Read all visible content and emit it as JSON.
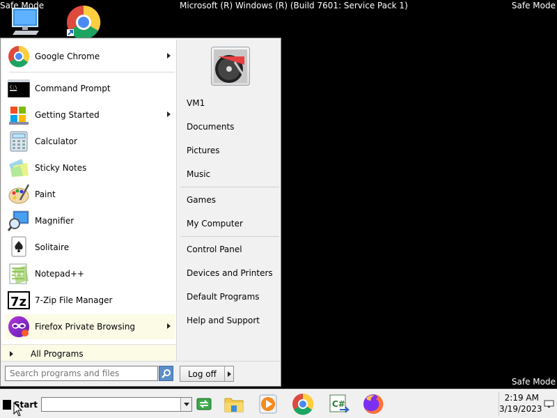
{
  "screen": {
    "safe_mode_label": "Safe Mode",
    "system_title": "Microsoft (R) Windows (R) (Build 7601: Service Pack 1)"
  },
  "desktop_icons": [
    {
      "name": "computer-icon"
    },
    {
      "name": "google-chrome-icon"
    }
  ],
  "start_menu": {
    "programs": [
      {
        "label": "Google Chrome",
        "icon": "chrome-icon",
        "has_submenu": true
      },
      {
        "label": "Command Prompt",
        "icon": "command-prompt-icon",
        "has_submenu": false
      },
      {
        "label": "Getting Started",
        "icon": "getting-started-icon",
        "has_submenu": true
      },
      {
        "label": "Calculator",
        "icon": "calculator-icon",
        "has_submenu": false
      },
      {
        "label": "Sticky Notes",
        "icon": "sticky-notes-icon",
        "has_submenu": false
      },
      {
        "label": "Paint",
        "icon": "paint-icon",
        "has_submenu": false
      },
      {
        "label": "Magnifier",
        "icon": "magnifier-icon",
        "has_submenu": false
      },
      {
        "label": "Solitaire",
        "icon": "solitaire-icon",
        "has_submenu": false
      },
      {
        "label": "Notepad++",
        "icon": "notepad-plus-plus-icon",
        "has_submenu": false
      },
      {
        "label": "7-Zip File Manager",
        "icon": "7zip-icon",
        "has_submenu": false
      },
      {
        "label": "Firefox Private Browsing",
        "icon": "firefox-private-icon",
        "has_submenu": true
      }
    ],
    "all_programs_label": "All Programs",
    "right_items": [
      {
        "label": "VM1"
      },
      {
        "label": "Documents"
      },
      {
        "label": "Pictures"
      },
      {
        "label": "Music"
      },
      {
        "label": "Games"
      },
      {
        "label": "My Computer"
      },
      {
        "label": "Control Panel"
      },
      {
        "label": "Devices and Printers"
      },
      {
        "label": "Default Programs"
      },
      {
        "label": "Help and Support"
      }
    ],
    "search_placeholder": "Search programs and files",
    "logoff_label": "Log off"
  },
  "taskbar": {
    "start_label": "Start",
    "address_value": "",
    "pinned_icons": [
      "file-explorer-icon",
      "media-player-icon",
      "chrome-icon",
      "csharp-project-icon",
      "firefox-icon"
    ],
    "clock_time": "2:19 AM",
    "clock_date": "3/19/2023"
  },
  "colors": {
    "desktop": "#000000",
    "menu_left": "#ffffff",
    "menu_right": "#f1f1f1",
    "highlight": "#fbfbe6"
  }
}
